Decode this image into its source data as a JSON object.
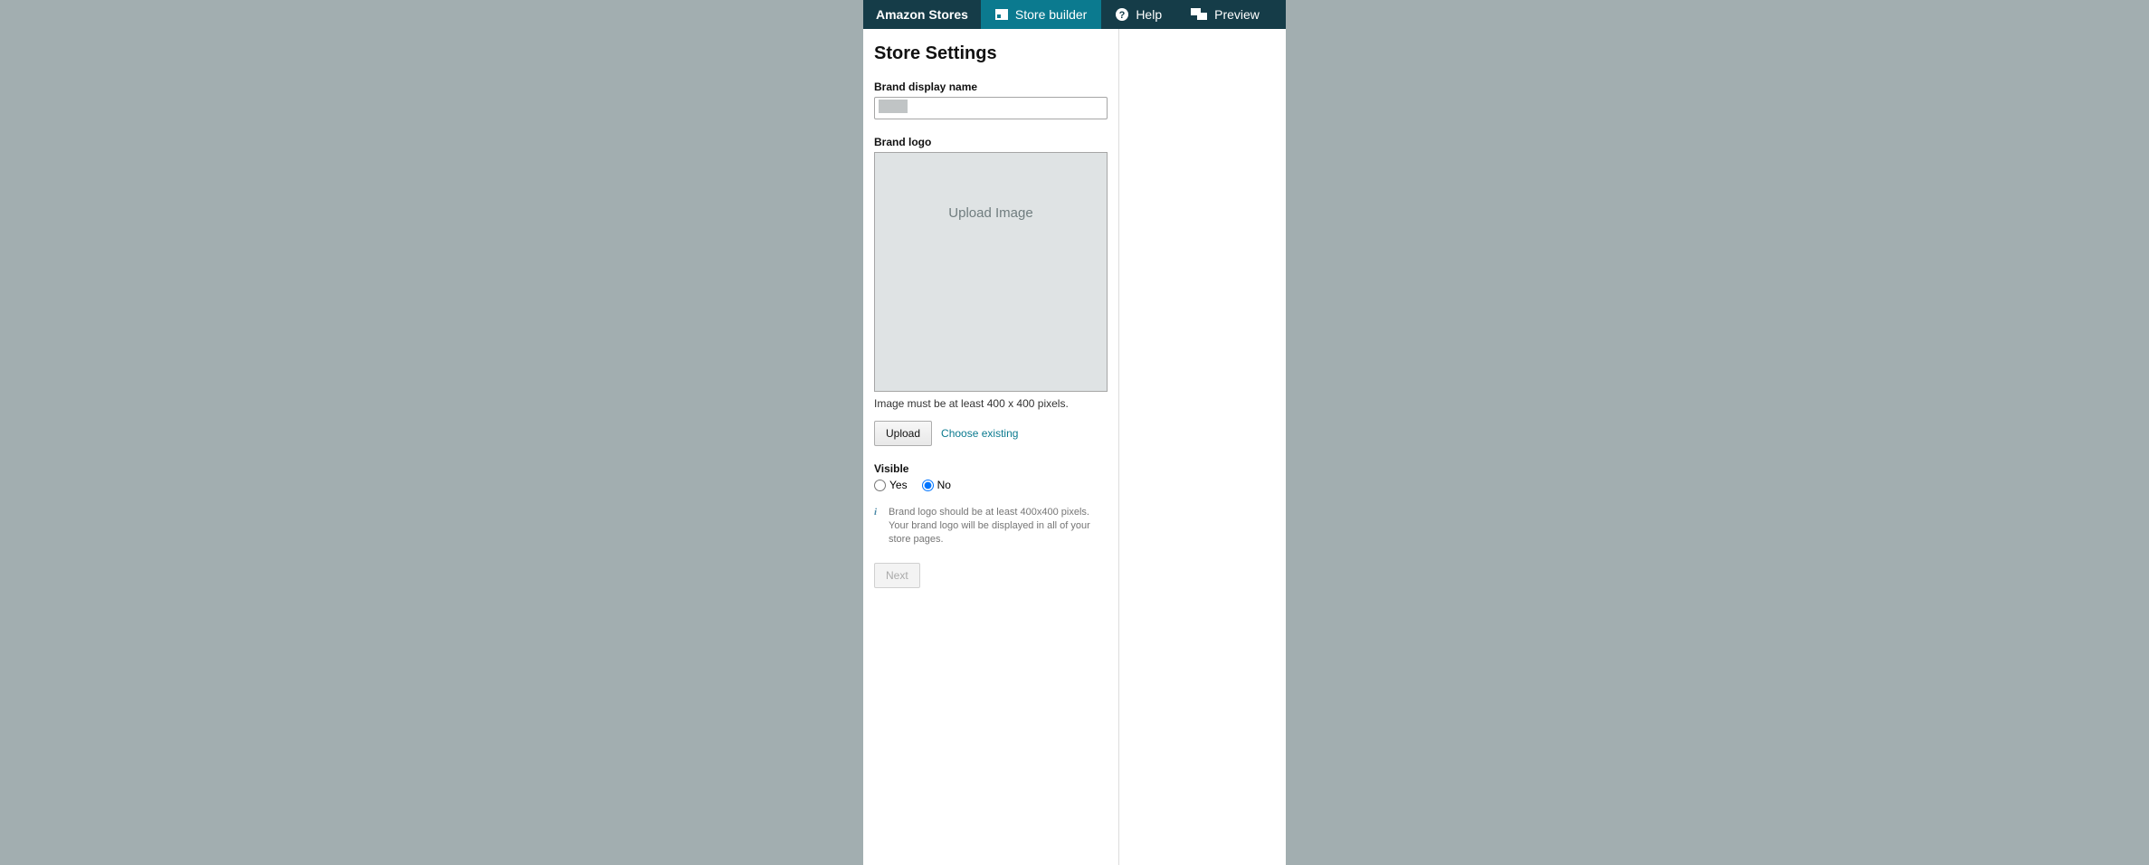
{
  "nav": {
    "logo": "Amazon Stores",
    "store_builder": "Store builder",
    "help": "Help",
    "preview": "Preview"
  },
  "page": {
    "title": "Store Settings"
  },
  "brand_name": {
    "label": "Brand display name",
    "value": ""
  },
  "brand_logo": {
    "label": "Brand logo",
    "upload_zone_text": "Upload Image",
    "hint": "Image must be at least 400 x 400 pixels.",
    "upload_btn": "Upload",
    "choose_existing": "Choose existing"
  },
  "visible": {
    "label": "Visible",
    "yes": "Yes",
    "no": "No",
    "selected": "no"
  },
  "info": {
    "text": "Brand logo should be at least 400x400 pixels. Your brand logo will be displayed in all of your store pages."
  },
  "next_btn": "Next"
}
